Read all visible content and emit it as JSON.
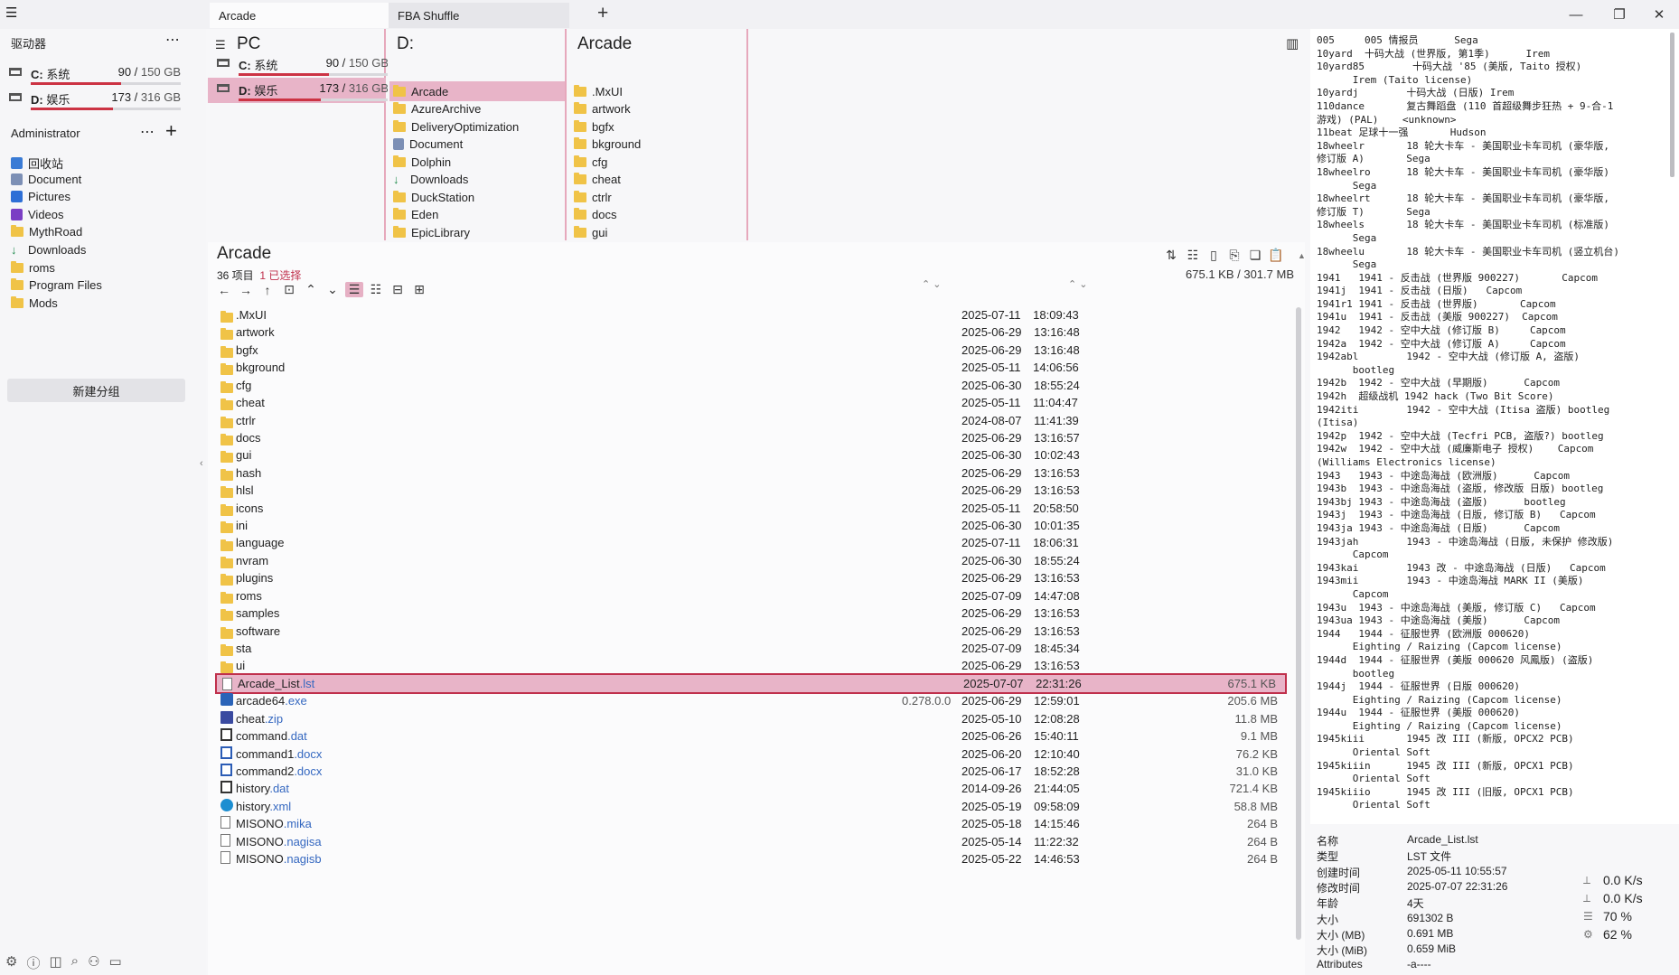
{
  "tabs": [
    {
      "label": "Arcade",
      "active": true
    },
    {
      "label": "FBA Shuffle",
      "active": false
    }
  ],
  "new_tab_label": "+",
  "window_controls": [
    "minimize",
    "maximize",
    "close"
  ],
  "sidebar": {
    "drives_header": "驱动器",
    "drives": [
      {
        "letter": "C:",
        "name": "系统",
        "used": "90",
        "total": "150 GB",
        "fill": 0.6
      },
      {
        "letter": "D:",
        "name": "娱乐",
        "used": "173",
        "total": "316 GB",
        "fill": 0.55
      }
    ],
    "user_header": "Administrator",
    "quick": [
      {
        "label": "回收站",
        "icon": "recycle-bin-icon"
      },
      {
        "label": "Document",
        "icon": "document-icon"
      },
      {
        "label": "Pictures",
        "icon": "pictures-icon"
      },
      {
        "label": "Videos",
        "icon": "videos-icon"
      },
      {
        "label": "MythRoad",
        "icon": "folder-icon"
      },
      {
        "label": "Downloads",
        "icon": "download-icon"
      },
      {
        "label": "roms",
        "icon": "folder-icon"
      },
      {
        "label": "Program Files",
        "icon": "folder-icon"
      },
      {
        "label": "Mods",
        "icon": "folder-icon"
      }
    ],
    "new_group_label": "新建分组"
  },
  "column_pc": {
    "title": "PC",
    "drives": [
      {
        "letter": "C:",
        "name": "系统",
        "used": "90",
        "total": "150 GB",
        "fill": 0.6,
        "selected": false
      },
      {
        "letter": "D:",
        "name": "娱乐",
        "used": "173",
        "total": "316 GB",
        "fill": 0.55,
        "selected": true
      }
    ]
  },
  "column_d": {
    "title": "D:",
    "items": [
      {
        "label": "Arcade",
        "selected": true
      },
      {
        "label": "AzureArchive",
        "selected": false
      },
      {
        "label": "DeliveryOptimization",
        "selected": false
      },
      {
        "label": "Document",
        "selected": false
      },
      {
        "label": "Dolphin",
        "selected": false
      },
      {
        "label": "Downloads",
        "selected": false
      },
      {
        "label": "DuckStation",
        "selected": false
      },
      {
        "label": "Eden",
        "selected": false
      },
      {
        "label": "EpicLibrary",
        "selected": false
      }
    ]
  },
  "column_arcade": {
    "title": "Arcade",
    "items": [
      ".MxUI",
      "artwork",
      "bgfx",
      "bkground",
      "cfg",
      "cheat",
      "ctrlr",
      "docs",
      "gui"
    ]
  },
  "main": {
    "title": "Arcade",
    "count": "36 项目",
    "selected": "1 已选择",
    "size_info": "675.1 KB / 301.7 MB",
    "files": [
      {
        "name": ".MxUI",
        "ext": "",
        "type": "folder",
        "date": "2025-07-11",
        "time": "18:09:43",
        "size": "",
        "version": ""
      },
      {
        "name": "artwork",
        "ext": "",
        "type": "folder",
        "date": "2025-06-29",
        "time": "13:16:48",
        "size": "",
        "version": ""
      },
      {
        "name": "bgfx",
        "ext": "",
        "type": "folder",
        "date": "2025-06-29",
        "time": "13:16:48",
        "size": "",
        "version": ""
      },
      {
        "name": "bkground",
        "ext": "",
        "type": "folder",
        "date": "2025-05-11",
        "time": "14:06:56",
        "size": "",
        "version": ""
      },
      {
        "name": "cfg",
        "ext": "",
        "type": "folder",
        "date": "2025-06-30",
        "time": "18:55:24",
        "size": "",
        "version": ""
      },
      {
        "name": "cheat",
        "ext": "",
        "type": "folder",
        "date": "2025-05-11",
        "time": "11:04:47",
        "size": "",
        "version": ""
      },
      {
        "name": "ctrlr",
        "ext": "",
        "type": "folder",
        "date": "2024-08-07",
        "time": "11:41:39",
        "size": "",
        "version": ""
      },
      {
        "name": "docs",
        "ext": "",
        "type": "folder",
        "date": "2025-06-29",
        "time": "13:16:57",
        "size": "",
        "version": ""
      },
      {
        "name": "gui",
        "ext": "",
        "type": "folder",
        "date": "2025-06-30",
        "time": "10:02:43",
        "size": "",
        "version": ""
      },
      {
        "name": "hash",
        "ext": "",
        "type": "folder",
        "date": "2025-06-29",
        "time": "13:16:53",
        "size": "",
        "version": ""
      },
      {
        "name": "hlsl",
        "ext": "",
        "type": "folder",
        "date": "2025-06-29",
        "time": "13:16:53",
        "size": "",
        "version": ""
      },
      {
        "name": "icons",
        "ext": "",
        "type": "folder",
        "date": "2025-05-11",
        "time": "20:58:50",
        "size": "",
        "version": ""
      },
      {
        "name": "ini",
        "ext": "",
        "type": "folder",
        "date": "2025-06-30",
        "time": "10:01:35",
        "size": "",
        "version": ""
      },
      {
        "name": "language",
        "ext": "",
        "type": "folder",
        "date": "2025-07-11",
        "time": "18:06:31",
        "size": "",
        "version": ""
      },
      {
        "name": "nvram",
        "ext": "",
        "type": "folder",
        "date": "2025-06-30",
        "time": "18:55:24",
        "size": "",
        "version": ""
      },
      {
        "name": "plugins",
        "ext": "",
        "type": "folder",
        "date": "2025-06-29",
        "time": "13:16:53",
        "size": "",
        "version": ""
      },
      {
        "name": "roms",
        "ext": "",
        "type": "folder",
        "date": "2025-07-09",
        "time": "14:47:08",
        "size": "",
        "version": ""
      },
      {
        "name": "samples",
        "ext": "",
        "type": "folder",
        "date": "2025-06-29",
        "time": "13:16:53",
        "size": "",
        "version": ""
      },
      {
        "name": "software",
        "ext": "",
        "type": "folder",
        "date": "2025-06-29",
        "time": "13:16:53",
        "size": "",
        "version": ""
      },
      {
        "name": "sta",
        "ext": "",
        "type": "folder",
        "date": "2025-07-09",
        "time": "18:45:34",
        "size": "",
        "version": ""
      },
      {
        "name": "ui",
        "ext": "",
        "type": "folder",
        "date": "2025-06-29",
        "time": "13:16:53",
        "size": "",
        "version": ""
      },
      {
        "name": "Arcade_List",
        "ext": ".lst",
        "type": "file",
        "date": "2025-07-07",
        "time": "22:31:26",
        "size": "675.1 KB",
        "version": "",
        "selected": true
      },
      {
        "name": "arcade64",
        "ext": ".exe",
        "type": "exe",
        "date": "2025-06-29",
        "time": "12:59:01",
        "size": "205.6 MB",
        "version": "0.278.0.0"
      },
      {
        "name": "cheat",
        "ext": ".zip",
        "type": "zip",
        "date": "2025-05-10",
        "time": "12:08:28",
        "size": "11.8 MB",
        "version": ""
      },
      {
        "name": "command",
        "ext": ".dat",
        "type": "dat",
        "date": "2025-06-26",
        "time": "15:40:11",
        "size": "9.1 MB",
        "version": ""
      },
      {
        "name": "command1",
        "ext": ".docx",
        "type": "docx",
        "date": "2025-06-20",
        "time": "12:10:40",
        "size": "76.2 KB",
        "version": ""
      },
      {
        "name": "command2",
        "ext": ".docx",
        "type": "docx",
        "date": "2025-06-17",
        "time": "18:52:28",
        "size": "31.0 KB",
        "version": ""
      },
      {
        "name": "history",
        "ext": ".dat",
        "type": "dat",
        "date": "2014-09-26",
        "time": "21:44:05",
        "size": "721.4 KB",
        "version": ""
      },
      {
        "name": "history",
        "ext": ".xml",
        "type": "edge",
        "date": "2025-05-19",
        "time": "09:58:09",
        "size": "58.8 MB",
        "version": ""
      },
      {
        "name": "MISONO",
        "ext": ".mika",
        "type": "file",
        "date": "2025-05-18",
        "time": "14:15:46",
        "size": "264 B",
        "version": ""
      },
      {
        "name": "MISONO",
        "ext": ".nagisa",
        "type": "file",
        "date": "2025-05-14",
        "time": "11:22:32",
        "size": "264 B",
        "version": ""
      },
      {
        "name": "MISONO",
        "ext": ".nagisb",
        "type": "file",
        "date": "2025-05-22",
        "time": "14:46:53",
        "size": "264 B",
        "version": ""
      }
    ]
  },
  "preview_lines": [
    "005     005 情报员      Sega",
    "10yard  十码大战 (世界版, 第1季)      Irem",
    "10yard85        十码大战 '85 (美版, Taito 授权)",
    "      Irem (Taito license)",
    "10yardj        十码大战 (日版) Irem",
    "110dance       复古舞蹈盘 (110 首超级舞步狂热 + 9-合-1",
    "游戏) (PAL)    <unknown>",
    "11beat 足球十一强       Hudson",
    "18wheelr       18 轮大卡车 - 美国职业卡车司机 (豪华版,",
    "修订版 A)       Sega",
    "18wheelro      18 轮大卡车 - 美国职业卡车司机 (豪华版)",
    "      Sega",
    "18wheelrt      18 轮大卡车 - 美国职业卡车司机 (豪华版,",
    "修订版 T)       Sega",
    "18wheels       18 轮大卡车 - 美国职业卡车司机 (标准版)",
    "      Sega",
    "18wheelu       18 轮大卡车 - 美国职业卡车司机 (竖立机台)",
    "      Sega",
    "1941   1941 - 反击战 (世界版 900227)       Capcom",
    "1941j  1941 - 反击战 (日版)   Capcom",
    "1941r1 1941 - 反击战 (世界版)       Capcom",
    "1941u  1941 - 反击战 (美版 900227)  Capcom",
    "1942   1942 - 空中大战 (修订版 B)     Capcom",
    "1942a  1942 - 空中大战 (修订版 A)     Capcom",
    "1942abl        1942 - 空中大战 (修订版 A, 盗版)",
    "      bootleg",
    "1942b  1942 - 空中大战 (早期版)      Capcom",
    "1942h  超级战机 1942 hack (Two Bit Score)",
    "1942iti        1942 - 空中大战 (Itisa 盗版) bootleg",
    "(Itisa)",
    "1942p  1942 - 空中大战 (Tecfri PCB, 盗版?) bootleg",
    "1942w  1942 - 空中大战 (威廉斯电子 授权)    Capcom",
    "(Williams Electronics license)",
    "1943   1943 - 中途岛海战 (欧洲版)      Capcom",
    "1943b  1943 - 中途岛海战 (盗版, 修改版 日版) bootleg",
    "1943bj 1943 - 中途岛海战 (盗版)      bootleg",
    "1943j  1943 - 中途岛海战 (日版, 修订版 B)   Capcom",
    "1943ja 1943 - 中途岛海战 (日版)      Capcom",
    "1943jah        1943 - 中途岛海战 (日版, 未保护 修改版)",
    "      Capcom",
    "1943kai        1943 改 - 中途岛海战 (日版)   Capcom",
    "1943mii        1943 - 中途岛海战 MARK II (美版)",
    "      Capcom",
    "1943u  1943 - 中途岛海战 (美版, 修订版 C)   Capcom",
    "1943ua 1943 - 中途岛海战 (美版)      Capcom",
    "1944   1944 - 征服世界 (欧洲版 000620)",
    "      Eighting / Raizing (Capcom license)",
    "1944d  1944 - 征服世界 (美版 000620 风鳳版) (盗版)",
    "      bootleg",
    "1944j  1944 - 征服世界 (日版 000620)",
    "      Eighting / Raizing (Capcom license)",
    "1944u  1944 - 征服世界 (美版 000620)",
    "      Eighting / Raizing (Capcom license)",
    "1945kiii       1945 改 III (新版, OPCX2 PCB)",
    "      Oriental Soft",
    "1945kiiin      1945 改 III (新版, OPCX1 PCB)",
    "      Oriental Soft",
    "1945kiiio      1945 改 III (旧版, OPCX1 PCB)",
    "      Oriental Soft"
  ],
  "properties": [
    {
      "key": "名称",
      "value": "Arcade_List.lst"
    },
    {
      "key": "类型",
      "value": "LST 文件"
    },
    {
      "key": "创建时间",
      "value": "2025-05-11  10:55:57"
    },
    {
      "key": "修改时间",
      "value": "2025-07-07  22:31:26"
    },
    {
      "key": "年龄",
      "value": "4天"
    },
    {
      "key": "大小",
      "value": "691302 B"
    },
    {
      "key": "大小 (MB)",
      "value": "0.691 MB"
    },
    {
      "key": "大小 (MiB)",
      "value": "0.659 MiB"
    },
    {
      "key": "Attributes",
      "value": "-a----"
    }
  ],
  "stats": [
    {
      "icon": "upload-speed-icon",
      "value": "0.0 K/s"
    },
    {
      "icon": "download-speed-icon",
      "value": "0.0 K/s"
    },
    {
      "icon": "memory-icon",
      "value": "70 %"
    },
    {
      "icon": "cpu-icon",
      "value": "62 %"
    }
  ]
}
